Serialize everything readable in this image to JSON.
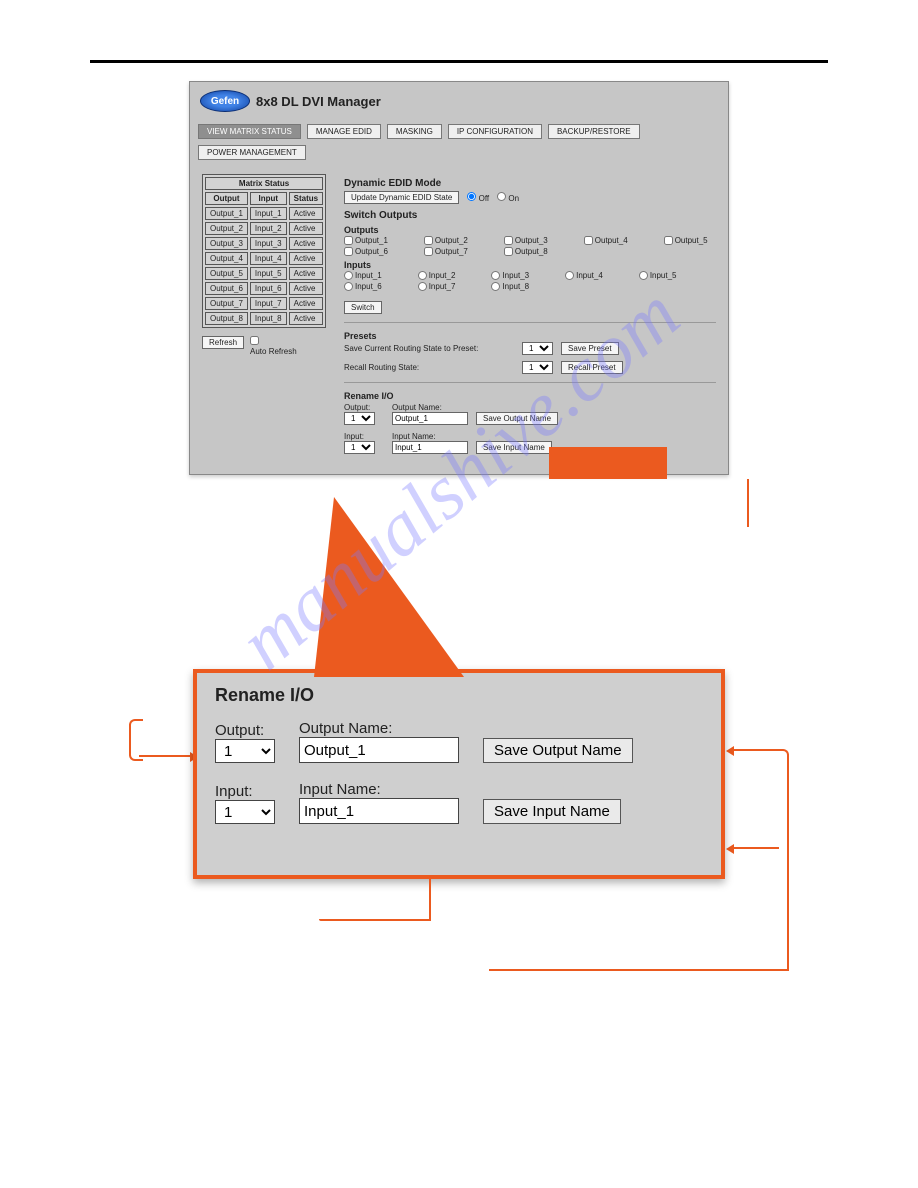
{
  "app_title": "8x8 DL DVI Manager",
  "logo_text": "Gefen",
  "tabs": [
    "VIEW MATRIX STATUS",
    "MANAGE EDID",
    "MASKING",
    "IP CONFIGURATION",
    "BACKUP/RESTORE",
    "POWER MANAGEMENT"
  ],
  "matrix": {
    "title": "Matrix Status",
    "headers": [
      "Output",
      "Input",
      "Status"
    ],
    "rows": [
      [
        "Output_1",
        "Input_1",
        "Active"
      ],
      [
        "Output_2",
        "Input_2",
        "Active"
      ],
      [
        "Output_3",
        "Input_3",
        "Active"
      ],
      [
        "Output_4",
        "Input_4",
        "Active"
      ],
      [
        "Output_5",
        "Input_5",
        "Active"
      ],
      [
        "Output_6",
        "Input_6",
        "Active"
      ],
      [
        "Output_7",
        "Input_7",
        "Active"
      ],
      [
        "Output_8",
        "Input_8",
        "Active"
      ]
    ]
  },
  "refresh_btn": "Refresh",
  "auto_refresh": "Auto Refresh",
  "dynamic": {
    "title": "Dynamic EDID Mode",
    "btn": "Update Dynamic EDID State",
    "off": "Off",
    "on": "On"
  },
  "switch": {
    "title": "Switch Outputs",
    "outputs_label": "Outputs",
    "outputs": [
      "Output_1",
      "Output_2",
      "Output_3",
      "Output_4",
      "Output_5",
      "Output_6",
      "Output_7",
      "Output_8"
    ],
    "inputs_label": "Inputs",
    "inputs": [
      "Input_1",
      "Input_2",
      "Input_3",
      "Input_4",
      "Input_5",
      "Input_6",
      "Input_7",
      "Input_8"
    ],
    "btn": "Switch"
  },
  "presets": {
    "title": "Presets",
    "save_label": "Save Current Routing State to Preset:",
    "save_btn": "Save Preset",
    "recall_label": "Recall Routing State:",
    "recall_btn": "Recall Preset",
    "value": "1"
  },
  "rename": {
    "title": "Rename I/O",
    "output_label": "Output:",
    "output_name_label": "Output Name:",
    "output_value": "1",
    "output_name_value": "Output_1",
    "save_output_btn": "Save Output Name",
    "input_label": "Input:",
    "input_name_label": "Input Name:",
    "input_value": "1",
    "input_name_value": "Input_1",
    "save_input_btn": "Save Input Name"
  },
  "watermark": "manualshive.com"
}
